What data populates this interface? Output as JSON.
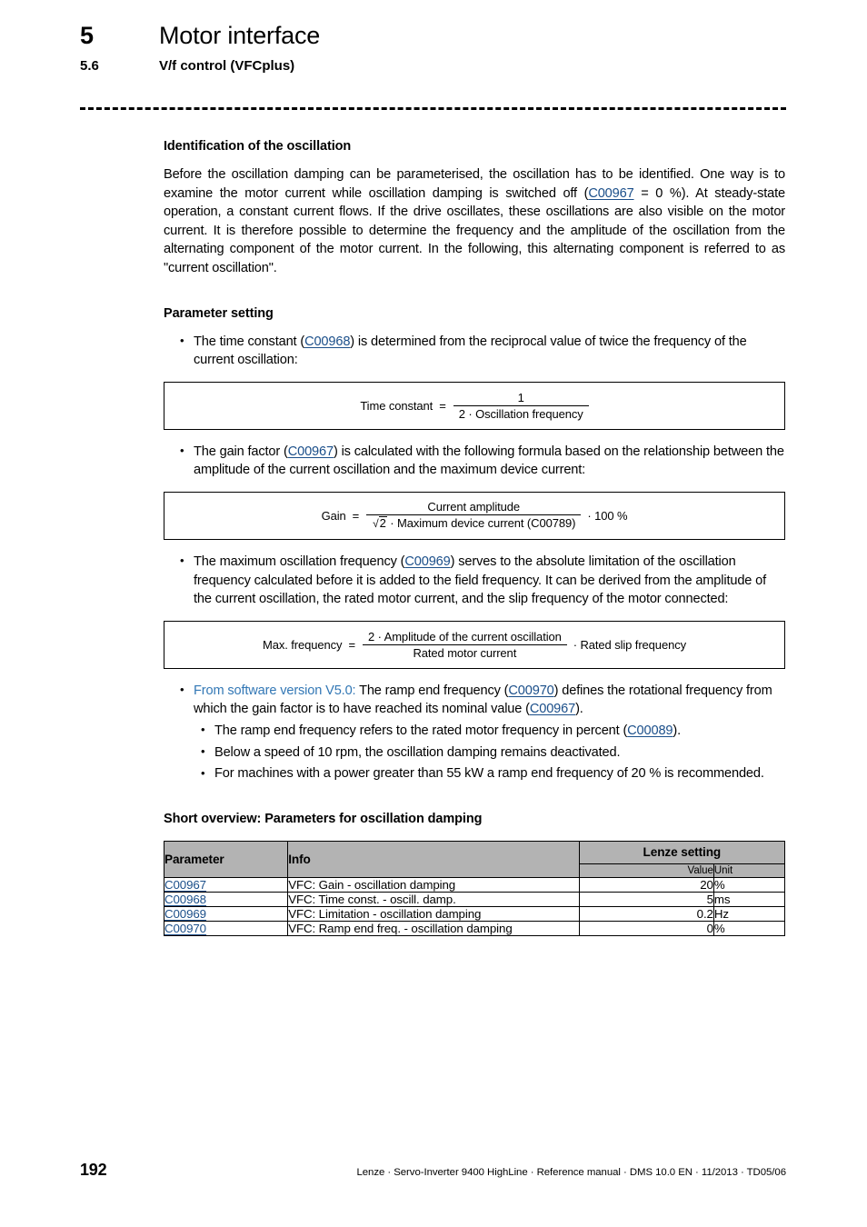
{
  "header": {
    "chapter_number": "5",
    "chapter_title": "Motor interface",
    "section_number": "5.6",
    "section_title": "V/f control (VFCplus)"
  },
  "sections": {
    "identification": {
      "heading": "Identification of the oscillation",
      "paragraph_part1": "Before the oscillation damping can be parameterised, the oscillation has to be identified. One way is to examine the motor current while oscillation damping is switched off (",
      "link1": "C00967",
      "paragraph_part2": " = 0 %). At steady-state operation, a constant current flows. If the drive oscillates, these oscillations are also visible on the motor current. It is therefore possible to determine the frequency and the amplitude of the oscillation from the alternating component of the motor current. In the following, this alternating component is referred to as \"current oscillation\"."
    },
    "parameter_setting": {
      "heading": "Parameter setting",
      "bullet1": {
        "text_before": "The time constant (",
        "link": "C00968",
        "text_after": ") is determined from the reciprocal value of twice the frequency of the current oscillation:"
      },
      "formula1": {
        "lhs": "Time constant",
        "equals": "=",
        "numerator": "1",
        "denominator": "2 · Oscillation frequency"
      },
      "bullet2": {
        "text_before": "The gain factor (",
        "link": "C00967",
        "text_after": ") is calculated with the following formula based on the relationship between the amplitude of the current oscillation and the maximum device current:"
      },
      "formula2": {
        "lhs": "Gain",
        "equals": "=",
        "numerator": "Current amplitude",
        "denominator_radicand": "2",
        "denominator_rest": "· Maximum device current (C00789)",
        "tail": "· 100 %"
      },
      "bullet3": {
        "text_before": "The maximum oscillation frequency (",
        "link": "C00969",
        "text_after": ") serves to the absolute limitation of the oscillation frequency calculated before it is added to the field frequency. It can be derived from the amplitude of the current oscillation, the rated motor current, and the slip frequency of the motor connected:"
      },
      "formula3": {
        "lhs": "Max. frequency",
        "equals": "=",
        "numerator": "2 · Amplitude of the current oscillation",
        "denominator": "Rated motor current",
        "tail": "· Rated slip frequency"
      },
      "bullet4": {
        "version_prefix": "From software version V5.0:",
        "text_before": " The ramp end frequency (",
        "link1": "C00970",
        "text_middle": ") defines the rotational frequency from which the gain factor is to have reached its nominal value (",
        "link2": "C00967",
        "text_after": ")."
      },
      "sub_bullets": [
        {
          "text_before": "The ramp end frequency refers to the rated motor frequency in percent (",
          "link": "C00089",
          "text_after": ")."
        },
        {
          "text_before": "Below a speed of 10 rpm, the oscillation damping remains deactivated.",
          "link": "",
          "text_after": ""
        },
        {
          "text_before": "For machines with a power greater than 55 kW a ramp end frequency of 20 % is recommended.",
          "link": "",
          "text_after": ""
        }
      ]
    },
    "short_overview": {
      "heading": "Short overview: Parameters for oscillation damping",
      "table": {
        "headers": {
          "parameter": "Parameter",
          "info": "Info",
          "lenze_setting": "Lenze setting",
          "value": "Value",
          "unit": "Unit"
        },
        "rows": [
          {
            "parameter": "C00967",
            "info": "VFC: Gain - oscillation damping",
            "value": "20",
            "unit": "%"
          },
          {
            "parameter": "C00968",
            "info": "VFC: Time const. - oscill. damp.",
            "value": "5",
            "unit": "ms"
          },
          {
            "parameter": "C00969",
            "info": "VFC: Limitation - oscillation damping",
            "value": "0.2",
            "unit": "Hz"
          },
          {
            "parameter": "C00970",
            "info": "VFC: Ramp end freq. - oscillation damping",
            "value": "0",
            "unit": "%"
          }
        ]
      }
    }
  },
  "footer": {
    "page_number": "192",
    "note": "Lenze · Servo-Inverter 9400 HighLine · Reference manual · DMS 10.0 EN · 11/2013 · TD05/06"
  },
  "colors": {
    "link": "#1b4f8a",
    "software_version": "#3277b5",
    "table_header_bg": "#b3b3b3"
  }
}
